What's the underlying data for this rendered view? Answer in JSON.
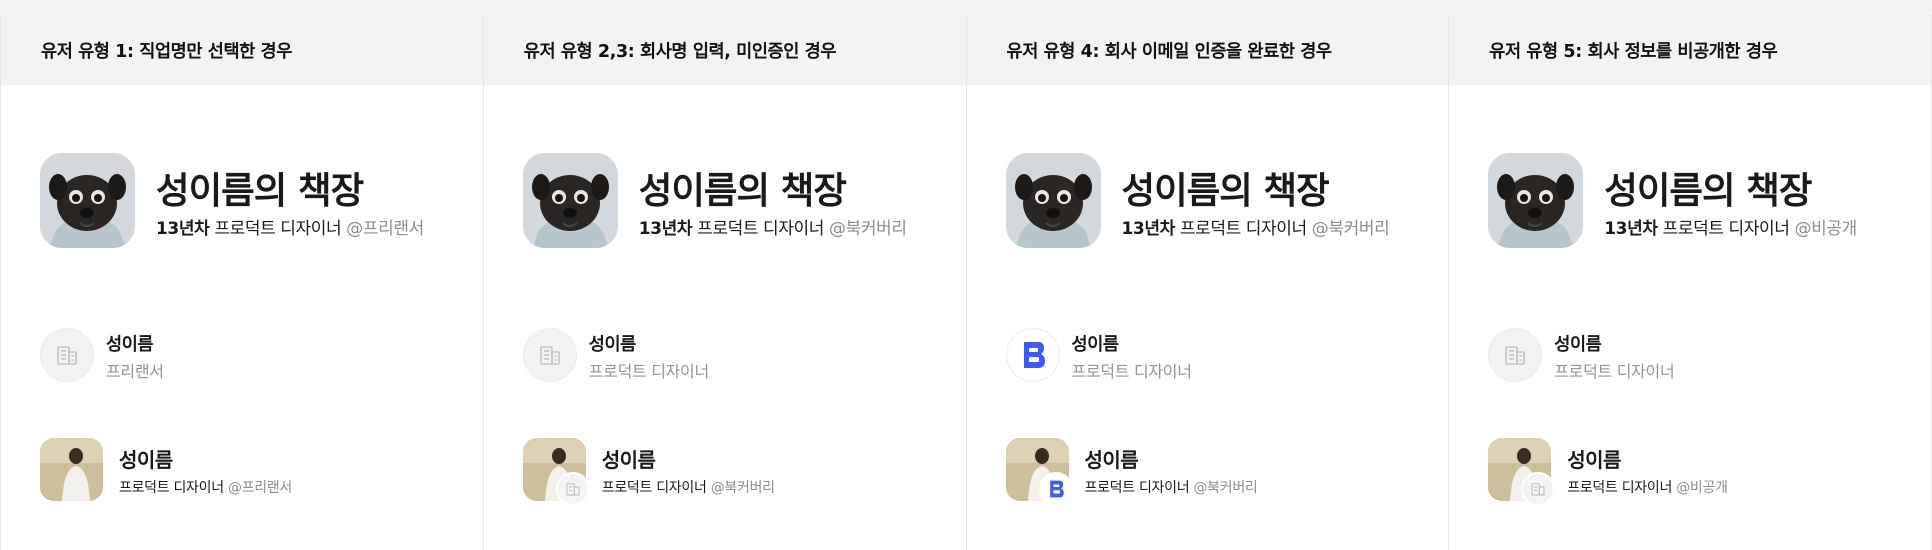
{
  "columns": [
    {
      "header": "유저 유형 1: 직업명만 선택한 경우",
      "profile_title": "성이름의 책장",
      "profile_years": "13년차",
      "profile_job": " 프로덕트 디자이너 ",
      "profile_company": "@프리랜서",
      "mid_icon": "building-icon",
      "mid_name": "성이름",
      "mid_sub": "프리랜서",
      "bot_name": "성이름",
      "bot_job": "프로덕트 디자이너 ",
      "bot_company": "@프리랜서",
      "bot_badge": "none"
    },
    {
      "header": "유저 유형 2,3: 회사명 입력, 미인증인 경우",
      "profile_title": "성이름의 책장",
      "profile_years": "13년차",
      "profile_job": " 프로덕트 디자이너 ",
      "profile_company": "@북커버리",
      "mid_icon": "building-icon",
      "mid_name": "성이름",
      "mid_sub": "프로덕트 디자이너",
      "bot_name": "성이름",
      "bot_job": "프로덕트 디자이너 ",
      "bot_company": "@북커버리",
      "bot_badge": "building-icon"
    },
    {
      "header": "유저 유형 4: 회사 이메일 인증을 완료한 경우",
      "profile_title": "성이름의 책장",
      "profile_years": "13년차",
      "profile_job": " 프로덕트 디자이너 ",
      "profile_company": "@북커버리",
      "mid_icon": "company-logo-icon",
      "mid_name": "성이름",
      "mid_sub": "프로덕트 디자이너",
      "bot_name": "성이름",
      "bot_job": "프로덕트 디자이너 ",
      "bot_company": "@북커버리",
      "bot_badge": "company-logo-icon"
    },
    {
      "header": "유저 유형 5: 회사 정보를 비공개한 경우",
      "profile_title": "성이름의 책장",
      "profile_years": "13년차",
      "profile_job": " 프로덕트 디자이너 ",
      "profile_company": "@비공개",
      "mid_icon": "building-icon",
      "mid_name": "성이름",
      "mid_sub": "프로덕트 디자이너",
      "bot_name": "성이름",
      "bot_job": "프로덕트 디자이너 ",
      "bot_company": "@비공개",
      "bot_badge": "building-icon"
    }
  ],
  "colors": {
    "brand_blue": "#3d5afe",
    "header_bg": "#f3f3f3",
    "muted_text": "#8d8d8d"
  }
}
